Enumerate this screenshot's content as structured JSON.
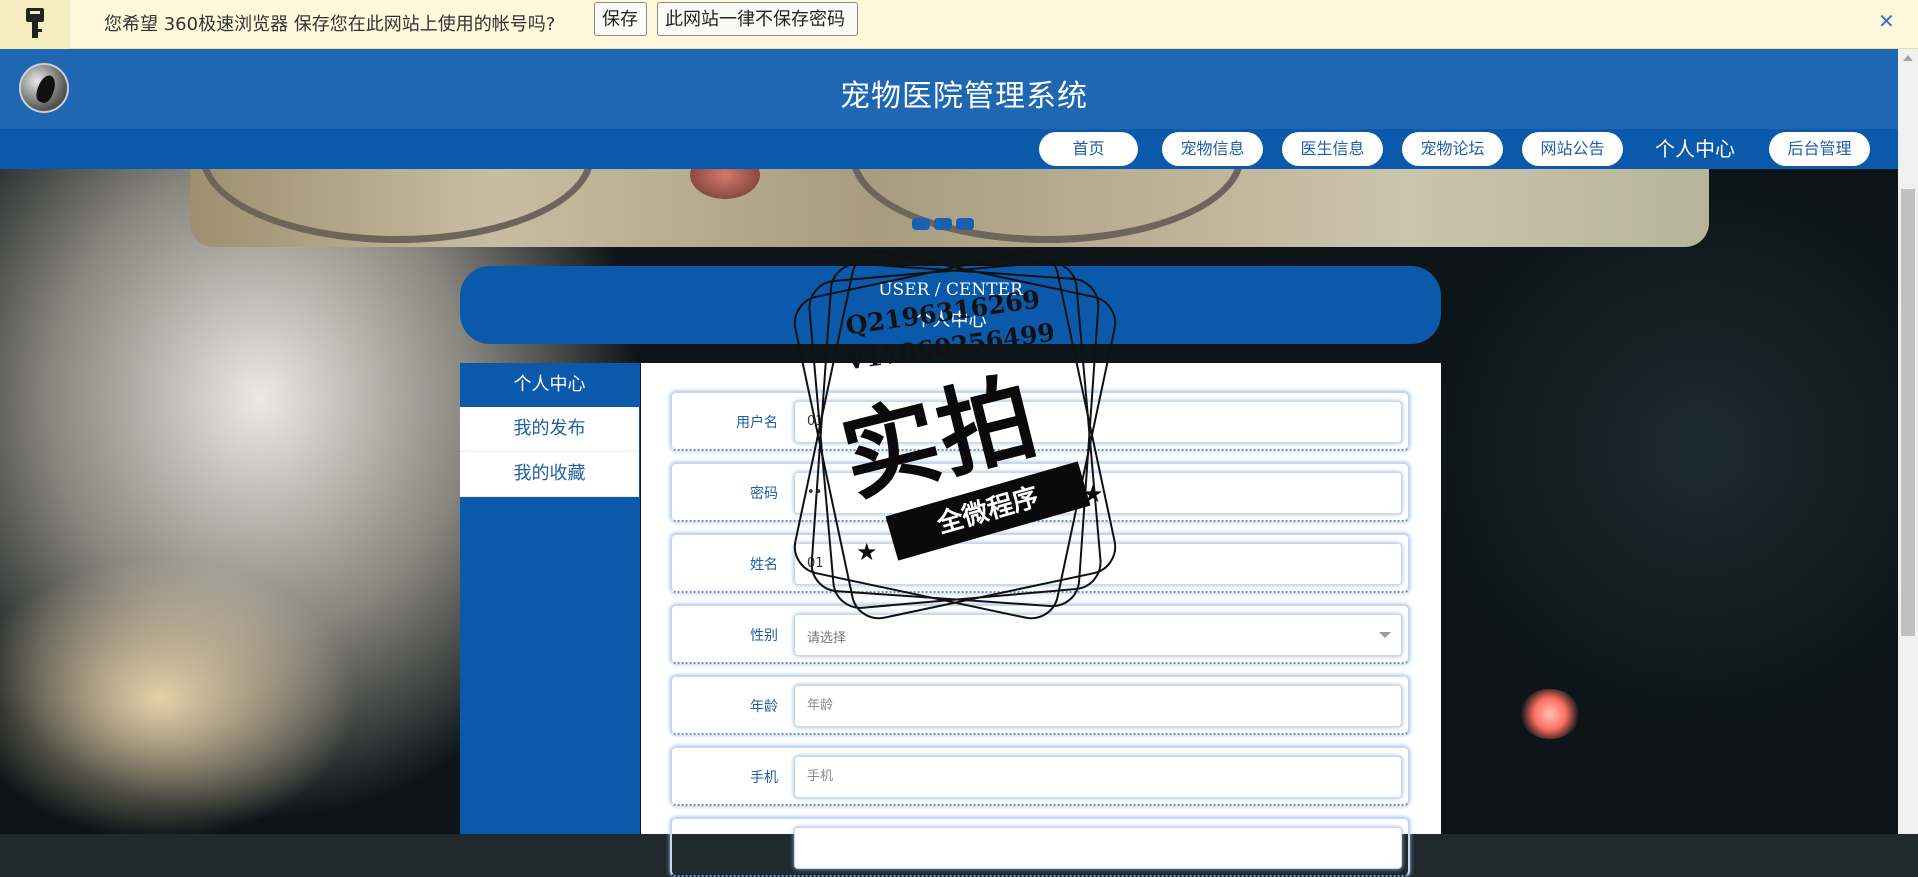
{
  "password_bar": {
    "icon": "key-icon",
    "message": "您希望 360极速浏览器 保存您在此网站上使用的帐号吗?",
    "save_label": "保存",
    "never_label": "此网站一律不保存密码",
    "close_glyph": "✕"
  },
  "header": {
    "title": "宠物医院管理系统",
    "avatar": "user-avatar"
  },
  "nav": {
    "items": [
      {
        "label": "首页"
      },
      {
        "label": "宠物信息"
      },
      {
        "label": "医生信息"
      },
      {
        "label": "宠物论坛"
      },
      {
        "label": "网站公告"
      },
      {
        "label": "个人中心"
      },
      {
        "label": "后台管理"
      }
    ]
  },
  "section": {
    "title_en": "USER / CENTER",
    "title_cn": "个人中心"
  },
  "sidebar": {
    "items": [
      {
        "label": "个人中心"
      },
      {
        "label": "我的发布"
      },
      {
        "label": "我的收藏"
      }
    ]
  },
  "form": {
    "fields": [
      {
        "label": "用户名",
        "value": "01",
        "placeholder": ""
      },
      {
        "label": "密码",
        "value": "••",
        "placeholder": ""
      },
      {
        "label": "姓名",
        "value": "01",
        "placeholder": ""
      },
      {
        "label": "性别",
        "value": "请选择",
        "placeholder": ""
      },
      {
        "label": "年龄",
        "value": "",
        "placeholder": "年龄"
      },
      {
        "label": "手机",
        "value": "",
        "placeholder": "手机"
      }
    ]
  },
  "watermark": {
    "line1": "Q2196316269",
    "line2": "V17060256499",
    "big": "实拍",
    "ribbon": "全微程序"
  },
  "colors": {
    "header_blue": "#1f66b3",
    "nav_blue": "#0b59ab",
    "bar_yellow": "#fff8dc"
  }
}
